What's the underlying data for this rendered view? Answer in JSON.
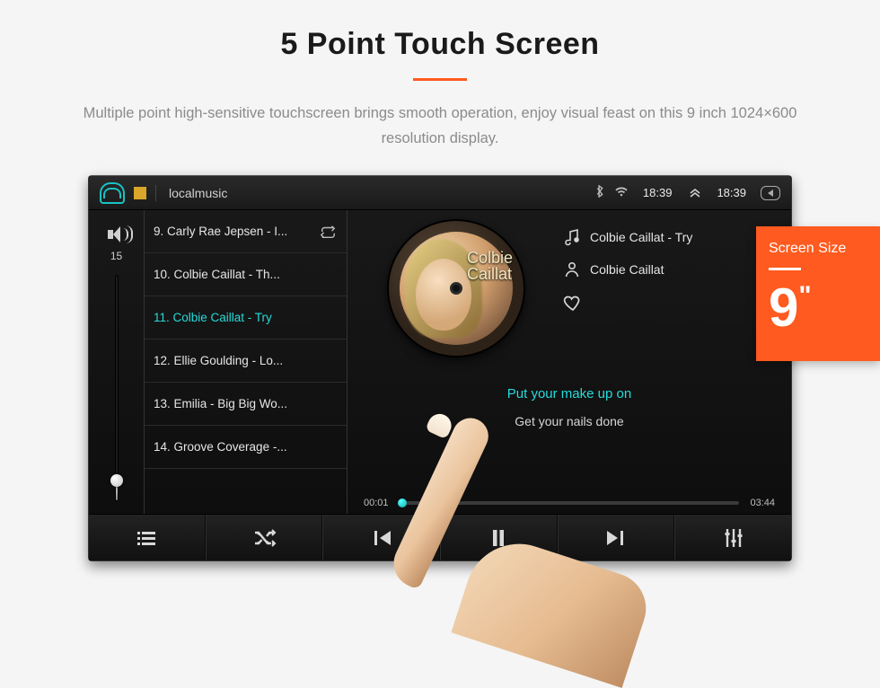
{
  "hero": {
    "title": "5 Point Touch Screen",
    "subtitle": "Multiple point high-sensitive touchscreen brings smooth operation, enjoy visual feast on this 9 inch 1024×600 resolution display."
  },
  "badge": {
    "label": "Screen Size",
    "value": "9",
    "unit": "\""
  },
  "statusbar": {
    "app_title": "localmusic",
    "clock1": "18:39",
    "clock2": "18:39"
  },
  "volume": {
    "level": "15"
  },
  "playlist": {
    "items": [
      "9. Carly Rae Jepsen - I...",
      "10. Colbie Caillat - Th...",
      "11. Colbie Caillat - Try",
      "12. Ellie Goulding - Lo...",
      "13. Emilia - Big Big Wo...",
      "14. Groove Coverage -..."
    ],
    "active_index": 2
  },
  "now_playing": {
    "album_script1": "Colbie",
    "album_script2": "Caillat",
    "song": "Colbie Caillat - Try",
    "artist": "Colbie Caillat"
  },
  "lyrics": {
    "current": "Put your make up on",
    "next": "Get your nails done"
  },
  "progress": {
    "elapsed": "00:01",
    "total": "03:44"
  }
}
